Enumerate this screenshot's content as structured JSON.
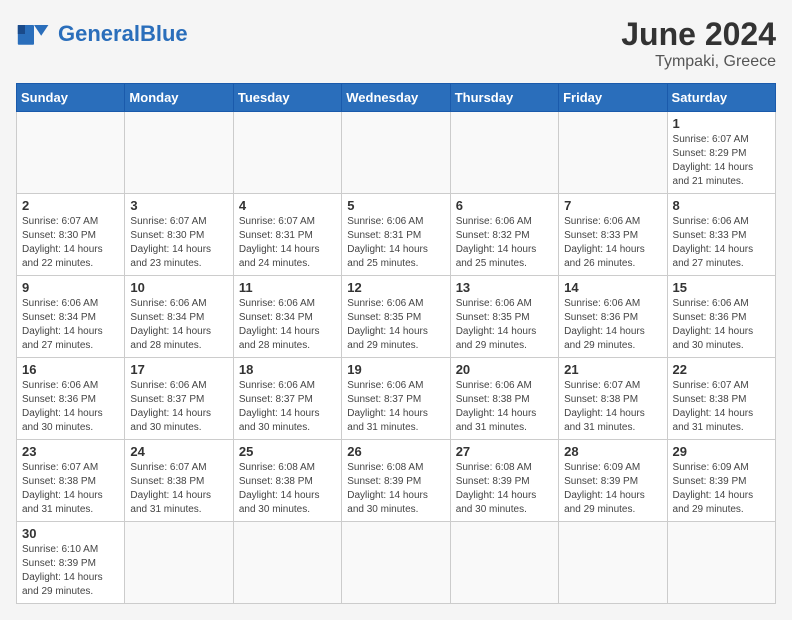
{
  "logo": {
    "text_general": "General",
    "text_blue": "Blue"
  },
  "header": {
    "month_year": "June 2024",
    "location": "Tympaki, Greece"
  },
  "weekdays": [
    "Sunday",
    "Monday",
    "Tuesday",
    "Wednesday",
    "Thursday",
    "Friday",
    "Saturday"
  ],
  "weeks": [
    [
      {
        "day": "",
        "info": ""
      },
      {
        "day": "",
        "info": ""
      },
      {
        "day": "",
        "info": ""
      },
      {
        "day": "",
        "info": ""
      },
      {
        "day": "",
        "info": ""
      },
      {
        "day": "",
        "info": ""
      },
      {
        "day": "1",
        "info": "Sunrise: 6:07 AM\nSunset: 8:29 PM\nDaylight: 14 hours and 21 minutes."
      }
    ],
    [
      {
        "day": "2",
        "info": "Sunrise: 6:07 AM\nSunset: 8:30 PM\nDaylight: 14 hours and 22 minutes."
      },
      {
        "day": "3",
        "info": "Sunrise: 6:07 AM\nSunset: 8:30 PM\nDaylight: 14 hours and 23 minutes."
      },
      {
        "day": "4",
        "info": "Sunrise: 6:07 AM\nSunset: 8:31 PM\nDaylight: 14 hours and 24 minutes."
      },
      {
        "day": "5",
        "info": "Sunrise: 6:06 AM\nSunset: 8:31 PM\nDaylight: 14 hours and 25 minutes."
      },
      {
        "day": "6",
        "info": "Sunrise: 6:06 AM\nSunset: 8:32 PM\nDaylight: 14 hours and 25 minutes."
      },
      {
        "day": "7",
        "info": "Sunrise: 6:06 AM\nSunset: 8:33 PM\nDaylight: 14 hours and 26 minutes."
      },
      {
        "day": "8",
        "info": "Sunrise: 6:06 AM\nSunset: 8:33 PM\nDaylight: 14 hours and 27 minutes."
      }
    ],
    [
      {
        "day": "9",
        "info": "Sunrise: 6:06 AM\nSunset: 8:34 PM\nDaylight: 14 hours and 27 minutes."
      },
      {
        "day": "10",
        "info": "Sunrise: 6:06 AM\nSunset: 8:34 PM\nDaylight: 14 hours and 28 minutes."
      },
      {
        "day": "11",
        "info": "Sunrise: 6:06 AM\nSunset: 8:34 PM\nDaylight: 14 hours and 28 minutes."
      },
      {
        "day": "12",
        "info": "Sunrise: 6:06 AM\nSunset: 8:35 PM\nDaylight: 14 hours and 29 minutes."
      },
      {
        "day": "13",
        "info": "Sunrise: 6:06 AM\nSunset: 8:35 PM\nDaylight: 14 hours and 29 minutes."
      },
      {
        "day": "14",
        "info": "Sunrise: 6:06 AM\nSunset: 8:36 PM\nDaylight: 14 hours and 29 minutes."
      },
      {
        "day": "15",
        "info": "Sunrise: 6:06 AM\nSunset: 8:36 PM\nDaylight: 14 hours and 30 minutes."
      }
    ],
    [
      {
        "day": "16",
        "info": "Sunrise: 6:06 AM\nSunset: 8:36 PM\nDaylight: 14 hours and 30 minutes."
      },
      {
        "day": "17",
        "info": "Sunrise: 6:06 AM\nSunset: 8:37 PM\nDaylight: 14 hours and 30 minutes."
      },
      {
        "day": "18",
        "info": "Sunrise: 6:06 AM\nSunset: 8:37 PM\nDaylight: 14 hours and 30 minutes."
      },
      {
        "day": "19",
        "info": "Sunrise: 6:06 AM\nSunset: 8:37 PM\nDaylight: 14 hours and 31 minutes."
      },
      {
        "day": "20",
        "info": "Sunrise: 6:06 AM\nSunset: 8:38 PM\nDaylight: 14 hours and 31 minutes."
      },
      {
        "day": "21",
        "info": "Sunrise: 6:07 AM\nSunset: 8:38 PM\nDaylight: 14 hours and 31 minutes."
      },
      {
        "day": "22",
        "info": "Sunrise: 6:07 AM\nSunset: 8:38 PM\nDaylight: 14 hours and 31 minutes."
      }
    ],
    [
      {
        "day": "23",
        "info": "Sunrise: 6:07 AM\nSunset: 8:38 PM\nDaylight: 14 hours and 31 minutes."
      },
      {
        "day": "24",
        "info": "Sunrise: 6:07 AM\nSunset: 8:38 PM\nDaylight: 14 hours and 31 minutes."
      },
      {
        "day": "25",
        "info": "Sunrise: 6:08 AM\nSunset: 8:38 PM\nDaylight: 14 hours and 30 minutes."
      },
      {
        "day": "26",
        "info": "Sunrise: 6:08 AM\nSunset: 8:39 PM\nDaylight: 14 hours and 30 minutes."
      },
      {
        "day": "27",
        "info": "Sunrise: 6:08 AM\nSunset: 8:39 PM\nDaylight: 14 hours and 30 minutes."
      },
      {
        "day": "28",
        "info": "Sunrise: 6:09 AM\nSunset: 8:39 PM\nDaylight: 14 hours and 29 minutes."
      },
      {
        "day": "29",
        "info": "Sunrise: 6:09 AM\nSunset: 8:39 PM\nDaylight: 14 hours and 29 minutes."
      }
    ],
    [
      {
        "day": "30",
        "info": "Sunrise: 6:10 AM\nSunset: 8:39 PM\nDaylight: 14 hours and 29 minutes."
      },
      {
        "day": "",
        "info": ""
      },
      {
        "day": "",
        "info": ""
      },
      {
        "day": "",
        "info": ""
      },
      {
        "day": "",
        "info": ""
      },
      {
        "day": "",
        "info": ""
      },
      {
        "day": "",
        "info": ""
      }
    ]
  ]
}
